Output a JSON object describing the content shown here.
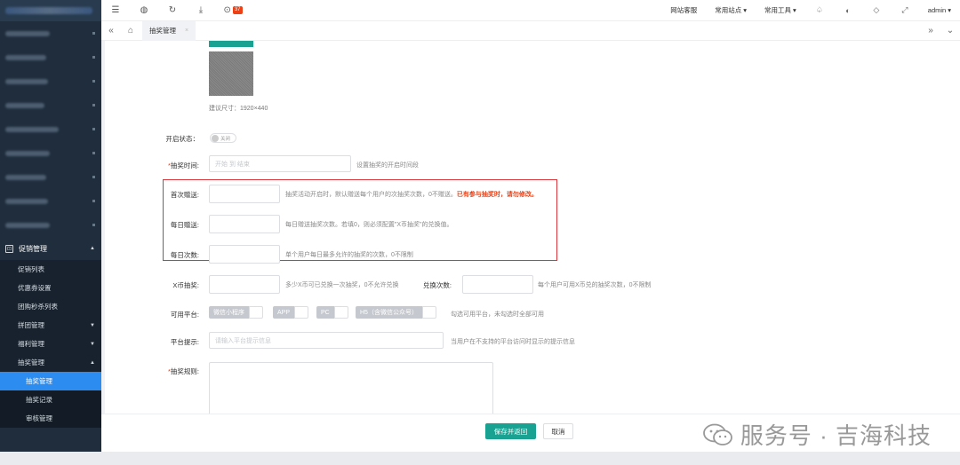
{
  "topbar": {
    "badge_count": "37",
    "links": [
      "网站客服",
      "常用站点",
      "常用工具"
    ],
    "user": "admin"
  },
  "tabs": [
    {
      "label": "抽奖管理"
    }
  ],
  "sidebar": {
    "group": "促销管理",
    "sub_items": [
      {
        "label": "促销列表"
      },
      {
        "label": "优惠券设置"
      },
      {
        "label": "团购秒杀列表"
      },
      {
        "label": "拼团管理"
      },
      {
        "label": "福利管理"
      },
      {
        "label": "抽奖管理"
      }
    ],
    "sub_sub_items": [
      {
        "label": "抽奖管理",
        "active": true
      },
      {
        "label": "抽奖记录"
      },
      {
        "label": "审核管理"
      }
    ]
  },
  "form": {
    "image_hint": "建议尺寸：1920×440",
    "status_label": "开启状态：",
    "status_switch_text": "关闭",
    "time_label": "抽奖时间:",
    "time_placeholder": "开始 到 结束",
    "time_hint": "设置抽奖的开启时间段",
    "first_gift_label": "首次赠送:",
    "first_gift_hint": "抽奖活动开启时，默认赠送每个用户的次抽奖次数，0不赠送。",
    "first_gift_warn": "已有参与抽奖时，请勿修改。",
    "daily_gift_label": "每日赠送:",
    "daily_gift_hint": "每日赠送抽奖次数。若填0，则必须配置\"X币抽奖\"的兑换值。",
    "daily_times_label": "每日次数:",
    "daily_times_hint": "单个用户每日最多允许的抽奖的次数，0不限制",
    "coin_label": "X币抽奖:",
    "coin_hint": "多少X币可已兑换一次抽奖，0不允许兑换",
    "exchange_label": "兑换次数:",
    "exchange_hint": "每个用户可用X币兑的抽奖次数，0不限制",
    "platform_label": "可用平台:",
    "platforms": [
      "微信小程序",
      "APP",
      "PC",
      "H5（含微信公众号）"
    ],
    "platform_hint": "勾选可用平台，未勾选时全部可用",
    "platform_tip_label": "平台提示:",
    "platform_tip_placeholder": "请输入平台提示信息",
    "platform_tip_hint": "当用户在不支持的平台访问时显示的提示信息",
    "rules_label": "抽奖规则:"
  },
  "footer": {
    "save_label": "保存并返回",
    "cancel_label": "取消"
  },
  "watermark": "服务号 · 吉海科技",
  "colors": {
    "sidebar_bg": "#1f2d3d",
    "active_blue": "#2d8cf0",
    "primary_green": "#19a291",
    "warn_red": "#ed4014"
  }
}
